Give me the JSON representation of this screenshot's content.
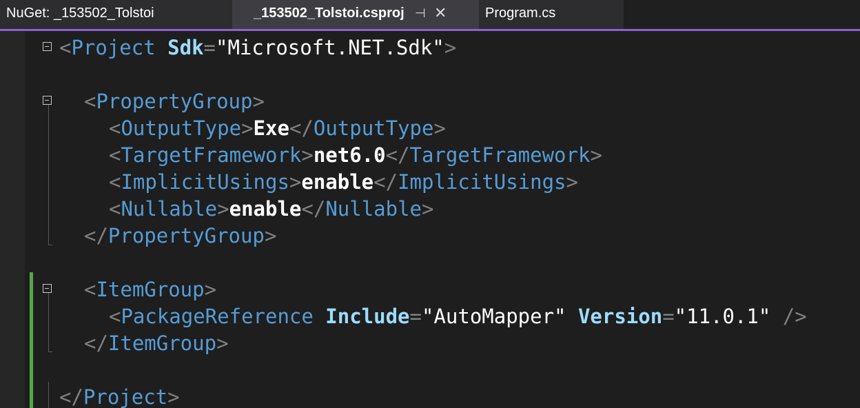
{
  "tabs": [
    {
      "label": "NuGet: _153502_Tolstoi",
      "active": false
    },
    {
      "label": "_153502_Tolstoi.csproj",
      "active": true,
      "pin_glyph": "⊣",
      "close_glyph": "✕"
    },
    {
      "label": "Program.cs",
      "active": false
    }
  ],
  "colors": {
    "background": "#1e1e1e",
    "accent": "#8a63d2",
    "tag": "#569cd6",
    "attribute": "#9cdcfe",
    "delimiter": "#808080",
    "change_bar": "#57a64a"
  },
  "code": {
    "project_tag": "Project",
    "sdk_attr": "Sdk",
    "sdk_value": "\"Microsoft.NET.Sdk\"",
    "property_group": "PropertyGroup",
    "output_type_tag": "OutputType",
    "output_type_value": "Exe",
    "target_framework_tag": "TargetFramework",
    "target_framework_value": "net6.0",
    "implicit_usings_tag": "ImplicitUsings",
    "implicit_usings_value": "enable",
    "nullable_tag": "Nullable",
    "nullable_value": "enable",
    "item_group": "ItemGroup",
    "package_reference_tag": "PackageReference",
    "include_attr": "Include",
    "include_value": "\"AutoMapper\"",
    "version_attr": "Version",
    "version_value": "\"11.0.1\""
  },
  "icons": {
    "fold": "minus-square-icon",
    "pin": "pin-icon",
    "close": "close-icon"
  }
}
